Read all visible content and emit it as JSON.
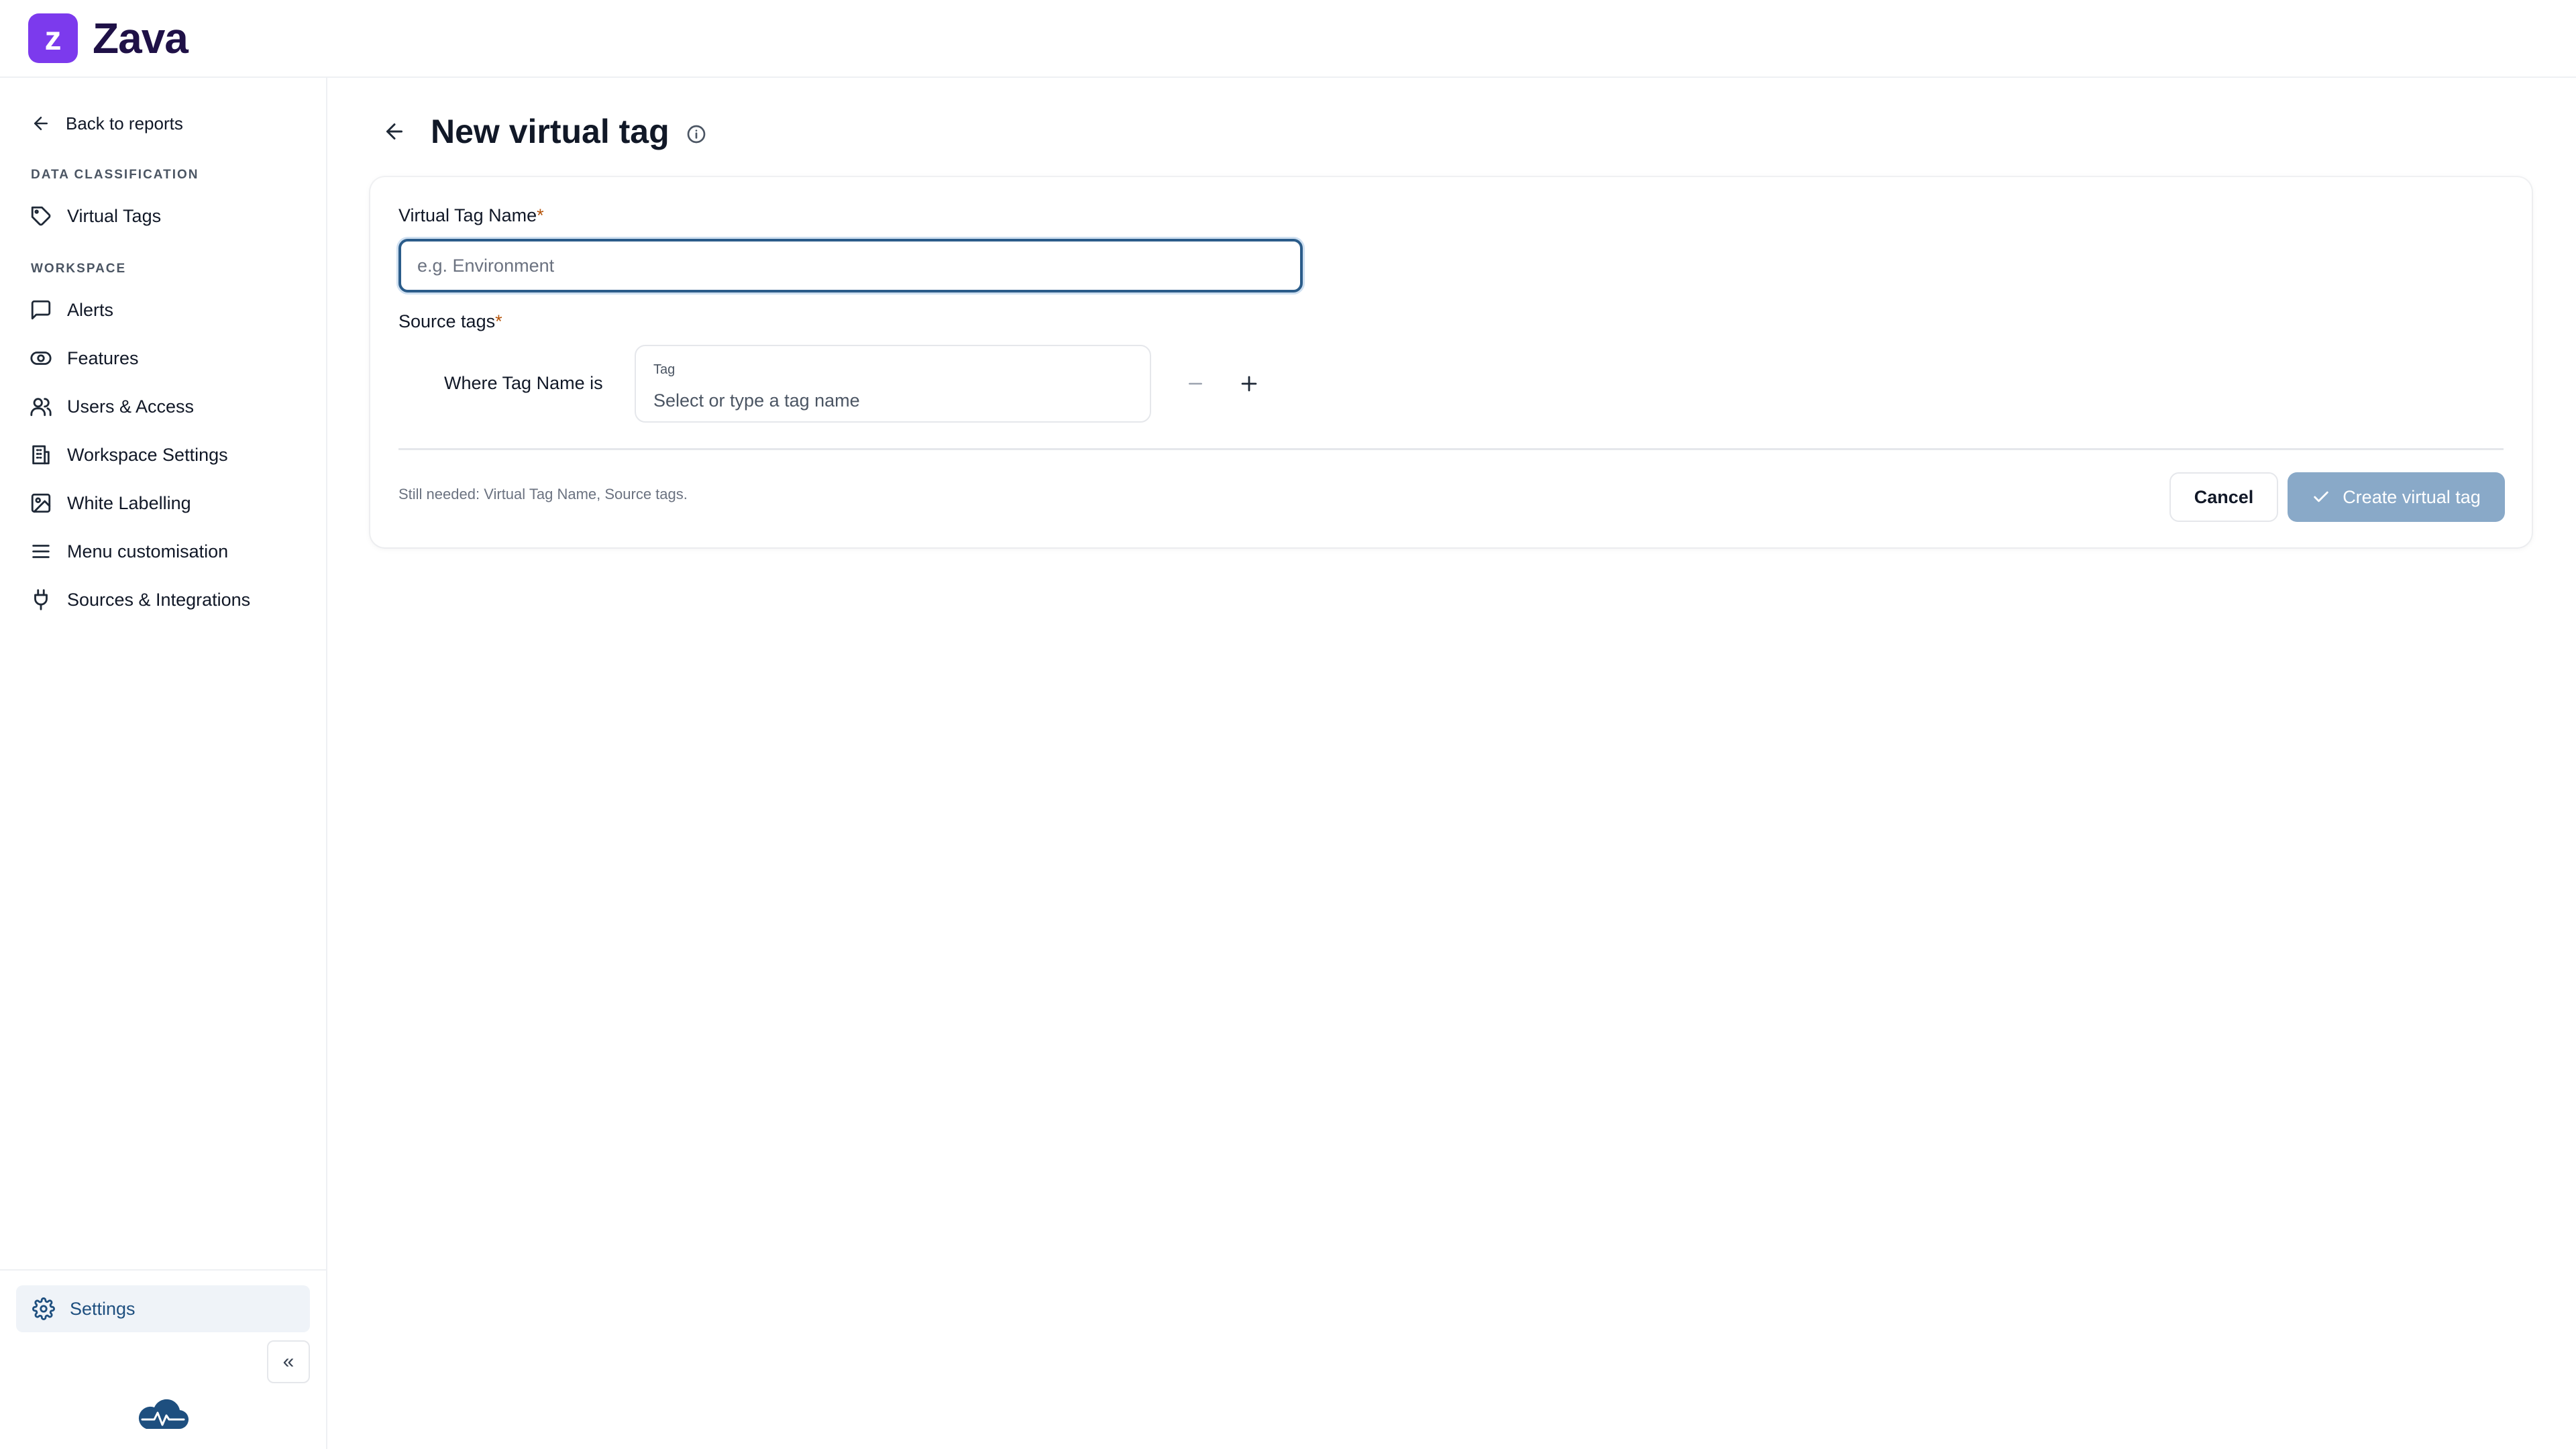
{
  "brand": {
    "name": "Zava",
    "mark": "z",
    "color": "#7c3aed"
  },
  "sidebar": {
    "back_label": "Back to reports",
    "sections": [
      {
        "label": "DATA CLASSIFICATION",
        "items": [
          {
            "label": "Virtual Tags",
            "icon": "tag-icon"
          }
        ]
      },
      {
        "label": "WORKSPACE",
        "items": [
          {
            "label": "Alerts",
            "icon": "message-square-icon"
          },
          {
            "label": "Features",
            "icon": "eye-icon"
          },
          {
            "label": "Users & Access",
            "icon": "users-icon"
          },
          {
            "label": "Workspace Settings",
            "icon": "building-icon"
          },
          {
            "label": "White Labelling",
            "icon": "image-icon"
          },
          {
            "label": "Menu customisation",
            "icon": "menu-icon"
          },
          {
            "label": "Sources & Integrations",
            "icon": "plug-icon"
          }
        ]
      }
    ],
    "settings_label": "Settings",
    "collapse_glyph": "«"
  },
  "page": {
    "title": "New virtual tag"
  },
  "form": {
    "name_label": "Virtual Tag Name",
    "required_mark": "*",
    "name_placeholder": "e.g. Environment",
    "source_label": "Source tags",
    "where_text": "Where Tag Name is",
    "tag_label": "Tag",
    "tag_placeholder": "Select or type a tag name",
    "still_needed": "Still needed: Virtual Tag Name, Source tags.",
    "cancel_label": "Cancel",
    "create_label": "Create virtual tag"
  },
  "colors": {
    "accent": "#2b5c8a",
    "create_disabled": "#89a9c8",
    "settings_active_bg": "#eff3f8"
  }
}
